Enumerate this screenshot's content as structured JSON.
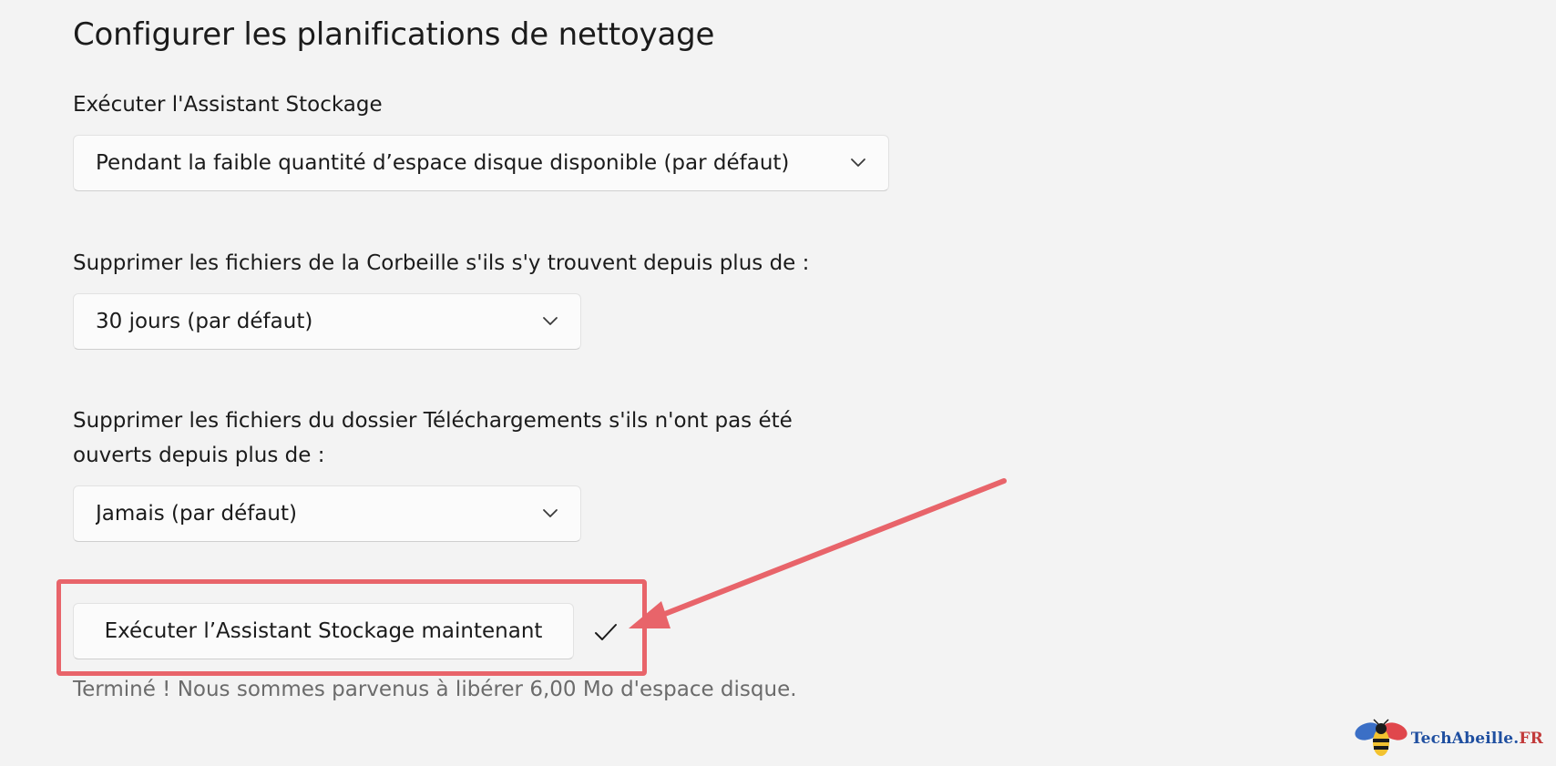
{
  "section": {
    "title": "Configurer les planifications de nettoyage"
  },
  "run_assistant": {
    "label": "Exécuter l'Assistant Stockage",
    "selected": "Pendant la faible quantité d’espace disque disponible (par défaut)"
  },
  "recycle_bin": {
    "label": "Supprimer les fichiers de la Corbeille s'ils s'y trouvent depuis plus de :",
    "selected": "30 jours (par défaut)"
  },
  "downloads": {
    "label_line1": "Supprimer les fichiers du dossier Téléchargements s'ils n'ont pas été",
    "label_line2": "ouverts depuis plus de :",
    "selected": "Jamais (par défaut)"
  },
  "run_now": {
    "button_label": "Exécuter l’Assistant Stockage maintenant",
    "status_icon": "checkmark-icon",
    "status_text": "Terminé ! Nous sommes parvenus à libérer 6,00 Mo d'espace disque."
  },
  "annotation": {
    "color": "#e8646a"
  },
  "watermark": {
    "brand": "TechAbeille",
    "dot": ".",
    "tld": "FR"
  }
}
